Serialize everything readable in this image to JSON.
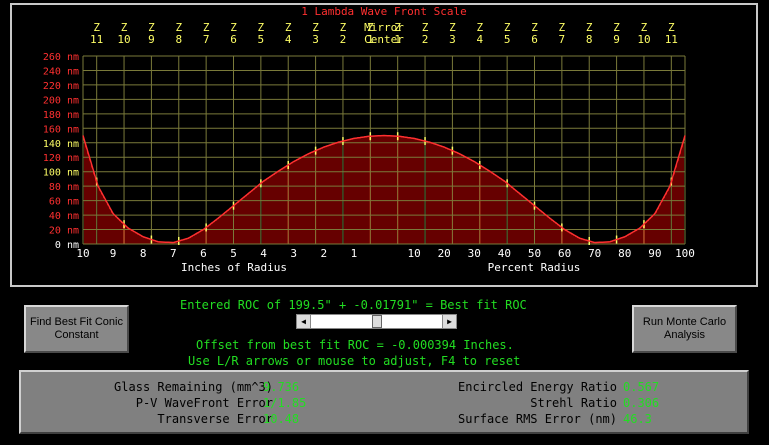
{
  "chart_data": {
    "type": "bar",
    "title": "1 Lambda Wave Front Scale",
    "y_unit": "nm",
    "ylim": [
      0,
      260
    ],
    "y_ticks": [
      0,
      20,
      40,
      60,
      80,
      100,
      120,
      140,
      160,
      180,
      200,
      220,
      240,
      260
    ],
    "y_tick_labels": [
      "0 nm",
      "20 nm",
      "40 nm",
      "60 nm",
      "80 nm",
      "100 nm",
      "120 nm",
      "140 nm",
      "160 nm",
      "180 nm",
      "200 nm",
      "220 nm",
      "240 nm",
      "260 nm"
    ],
    "center_label_top": "Mirror",
    "center_label_bottom": "Center",
    "zone_prefix": "Z",
    "zones_left": [
      "11",
      "10",
      "9",
      "8",
      "7",
      "6",
      "5",
      "4",
      "3",
      "2",
      "1"
    ],
    "zones_right": [
      "1",
      "2",
      "3",
      "4",
      "5",
      "6",
      "7",
      "8",
      "9",
      "10",
      "11"
    ],
    "x_ticks_left": [
      "10",
      "9",
      "8",
      "7",
      "6",
      "5",
      "4",
      "3",
      "2",
      "1"
    ],
    "x_ticks_right": [
      "10",
      "20",
      "30",
      "40",
      "50",
      "60",
      "70",
      "80",
      "90",
      "100"
    ],
    "xlabel_left": "Inches of Radius",
    "xlabel_right": "Percent Radius",
    "series": [
      {
        "percent_radius": [
          0,
          5,
          10,
          15,
          20,
          25,
          30,
          35,
          40,
          45,
          50,
          55,
          60,
          65,
          70,
          75,
          80,
          85,
          90,
          95,
          100
        ],
        "values": [
          150,
          149,
          146,
          141,
          134,
          125,
          114,
          101,
          87,
          70,
          53,
          36,
          20,
          8,
          2,
          3,
          10,
          22,
          42,
          80,
          150
        ]
      }
    ],
    "colors": {
      "bars": "#cc0000",
      "curve": "#ff3030",
      "grid": "#7a7a3a",
      "zone_marks": "#ffff66",
      "title": "#ff3030",
      "axis_labels": "#ffff66"
    }
  },
  "roc": {
    "entered_line": "Entered ROC of 199.5\" + -0.01791\" = Best fit ROC",
    "offset_line": "Offset from best fit ROC = -0.000394 Inches.",
    "help_line": "Use L/R arrows or mouse to adjust, F4 to reset",
    "slider_value": 0.5
  },
  "buttons": {
    "find_best_fit": "Find Best Fit Conic Constant",
    "monte_carlo": "Run Monte Carlo Analysis"
  },
  "stats": {
    "glass_remaining_label": "Glass Remaining (mm^3)",
    "glass_remaining_value": "9.736",
    "pv_label": "P-V WaveFront Error",
    "pv_value": "1/1.85",
    "transverse_label": "Transverse Error",
    "transverse_value": "10.48",
    "encircled_label": "Encircled Energy Ratio",
    "encircled_value": "0.567",
    "strehl_label": "Strehl Ratio",
    "strehl_value": "0.306",
    "surface_rms_label": "Surface RMS Error (nm)",
    "surface_rms_value": "46.3"
  }
}
